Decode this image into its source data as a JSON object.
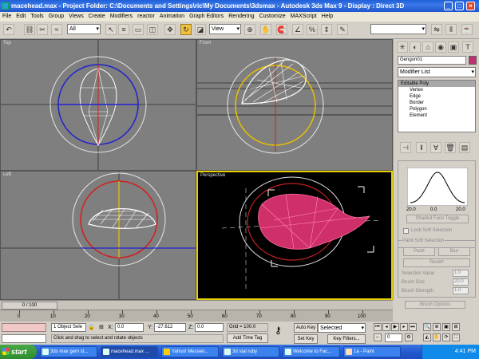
{
  "window": {
    "title": "macehead.max - Project Folder: C:\\Documents and Settings\\ric\\My Documents\\3dsmax - Autodesk 3ds Max 9 - Display : Direct 3D"
  },
  "menu": [
    "File",
    "Edit",
    "Tools",
    "Group",
    "Views",
    "Create",
    "Modifiers",
    "reactor",
    "Animation",
    "Graph Editors",
    "Rendering",
    "Customize",
    "MAXScript",
    "Help"
  ],
  "toolbar": {
    "selection_filter": "All",
    "ref_coord": "View"
  },
  "viewports": {
    "top": "Top",
    "front": "Front",
    "left": "Left",
    "perspective": "Perspective"
  },
  "command_panel": {
    "object_name": "Gengon01",
    "modifier_list": "Modifier List",
    "stack": [
      "Editable Poly",
      "Vertex",
      "Edge",
      "Border",
      "Polygon",
      "Element"
    ],
    "curve_left": "20.0",
    "curve_center": "0.0",
    "curve_right": "20.0",
    "shaded_face_toggle": "Shaded Face Toggle",
    "lock_soft_selection": "Lock Soft Selection",
    "paint_soft_selection": "Paint Soft Selection",
    "paint": "Paint",
    "blur": "Blur",
    "revert": "Revert",
    "selection_value_label": "Selection Value",
    "selection_value": "1.0",
    "brush_size_label": "Brush Size",
    "brush_size": "20.0",
    "brush_strength_label": "Brush Strength",
    "brush_strength": "1.0",
    "brush_options": "Brush Options"
  },
  "timeline": {
    "frame_display": "0 / 100",
    "ticks": [
      "0",
      "10",
      "20",
      "30",
      "40",
      "50",
      "60",
      "70",
      "80",
      "90",
      "100"
    ]
  },
  "status": {
    "selection_count": "1 Object Sele",
    "prompt": "Click and drag to select and rotate objects",
    "x_label": "X:",
    "x": "0.0",
    "y_label": "Y:",
    "y": "-27.612",
    "z_label": "Z:",
    "z": "0.0",
    "grid": "Grid = 100.0",
    "add_time_tag": "Add Time Tag",
    "auto_key": "Auto Key",
    "auto_key_mode": "Selected",
    "set_key": "Set Key",
    "key_filters": "Key Filters...",
    "current_frame": "0"
  },
  "taskbar": {
    "start": "start",
    "tasks": [
      "3ds max gem st...",
      "macehead.max ...",
      "Yahoo! Messen...",
      "3d stal ruby",
      "Welcome to Fac...",
      "1a - Paint"
    ],
    "clock": "4:41 PM"
  },
  "colors": {
    "viewport_gray": "#7f7f7f",
    "active_viewport_border": "#e8d000",
    "gem_color": "#d0306a"
  }
}
